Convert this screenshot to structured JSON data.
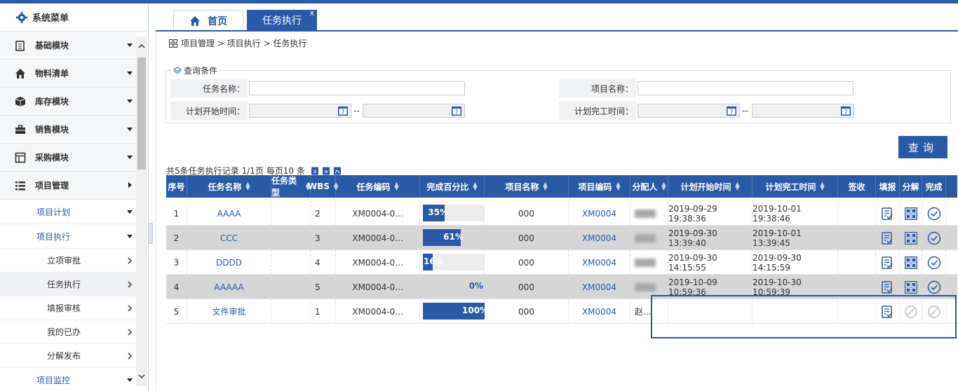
{
  "sidebar": {
    "title": "系统菜单",
    "menus": [
      {
        "label": "基础模块",
        "icon": "clipboard-icon"
      },
      {
        "label": "物料清单",
        "icon": "home-icon"
      },
      {
        "label": "库存模块",
        "icon": "box-icon"
      },
      {
        "label": "销售模块",
        "icon": "briefcase-icon"
      },
      {
        "label": "采购模块",
        "icon": "grid-icon"
      },
      {
        "label": "项目管理",
        "icon": "list-icon"
      }
    ],
    "sub_plan": "项目计划",
    "sub_exec": "项目执行",
    "subsub": [
      "立项审批",
      "任务执行",
      "填报审核",
      "我的已办",
      "分解发布"
    ],
    "sub_monitor": "项目监控"
  },
  "tabs": {
    "home": "首页",
    "task": "任务执行",
    "close": "x"
  },
  "breadcrumb": "项目管理 > 项目执行 > 任务执行",
  "query": {
    "legend": "查询条件",
    "task_name_label": "任务名称：",
    "project_name_label": "项目名称：",
    "plan_start_label": "计划开始时间：",
    "plan_end_label": "计划完工时间：",
    "range_sep": "--",
    "button": "查询"
  },
  "summary": {
    "total": "共5条任务执行记录",
    "page": "1/1页 每页10",
    "unit": "条"
  },
  "columns": [
    "序号",
    "任务名称",
    "任务类型",
    "WBS",
    "任务编码",
    "完成百分比",
    "项目名称",
    "项目编码",
    "分配人",
    "计划开始时间",
    "计划完工时间",
    "签收",
    "填报",
    "分解",
    "完成"
  ],
  "rows": [
    {
      "no": "1",
      "name": "AAAA",
      "type": "",
      "wbs": "2",
      "code": "XM0004-0...",
      "pct": 35,
      "pct_label": "35%",
      "pname": "000",
      "pcode": "XM0004",
      "assignee": "",
      "start": "2019-09-29 19:38:36",
      "end": "2019-10-01 19:38:46"
    },
    {
      "no": "2",
      "name": "CCC",
      "type": "",
      "wbs": "3",
      "code": "XM0004-0...",
      "pct": 61,
      "pct_label": "61%",
      "pname": "000",
      "pcode": "XM0004",
      "assignee": "",
      "start": "2019-09-30 13:39:40",
      "end": "2019-10-01 13:39:45"
    },
    {
      "no": "3",
      "name": "DDDD",
      "type": "",
      "wbs": "4",
      "code": "XM0004-0...",
      "pct": 16,
      "pct_label": "16%",
      "pname": "000",
      "pcode": "XM0004",
      "assignee": "",
      "start": "2019-09-30 14:15:55",
      "end": "2019-09-30 14:15:59"
    },
    {
      "no": "4",
      "name": "AAAAA",
      "type": "",
      "wbs": "5",
      "code": "XM0004-0...",
      "pct": 0,
      "pct_label": "0%",
      "pname": "000",
      "pcode": "XM0004",
      "assignee": "",
      "start": "2019-10-09 10:59:36",
      "end": "2019-10-30 10:59:39"
    },
    {
      "no": "5",
      "name": "文件审批",
      "type": "",
      "wbs": "1",
      "code": "XM0004-0...",
      "pct": 100,
      "pct_label": "100%",
      "pname": "000",
      "pcode": "XM0004",
      "assignee": "赵...",
      "start": "",
      "end": ""
    }
  ],
  "colors": {
    "brand": "#2a5aa5",
    "alt_row": "#d6d6d6"
  }
}
